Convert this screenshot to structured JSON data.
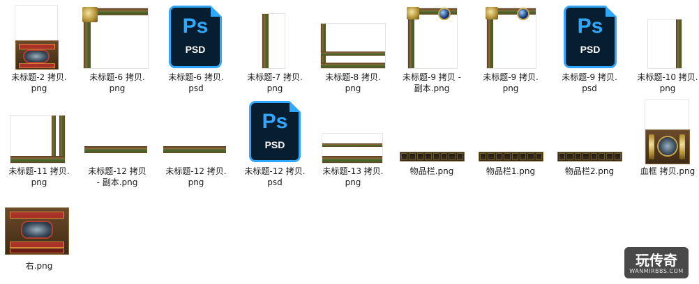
{
  "files": [
    {
      "name": "未标题-2 拷贝.png",
      "line1": "未标题-2 拷贝.",
      "line2": "png",
      "kind": "png-ornate-tall"
    },
    {
      "name": "未标题-6 拷贝.png",
      "line1": "未标题-6 拷贝.",
      "line2": "png",
      "kind": "png-frame-corner"
    },
    {
      "name": "未标题-6 拷贝.psd",
      "line1": "未标题-6 拷贝.",
      "line2": "psd",
      "kind": "psd"
    },
    {
      "name": "未标题-7 拷贝.png",
      "line1": "未标题-7 拷贝.",
      "line2": "png",
      "kind": "png-vertical-strip"
    },
    {
      "name": "未标题-8 拷贝.png",
      "line1": "未标题-8 拷贝.",
      "line2": "png",
      "kind": "png-frame-wide"
    },
    {
      "name": "未标题-9 拷贝 - 副本.png",
      "line1": "未标题-9 拷贝 -",
      "line2": "副本.png",
      "kind": "png-frame-gem"
    },
    {
      "name": "未标题-9 拷贝.png",
      "line1": "未标题-9 拷贝.",
      "line2": "png",
      "kind": "png-frame-gem"
    },
    {
      "name": "未标题-9 拷贝.psd",
      "line1": "未标题-9 拷贝.",
      "line2": "psd",
      "kind": "psd"
    },
    {
      "name": "未标题-10 拷贝.png",
      "line1": "未标题-10 拷贝.",
      "line2": "png",
      "kind": "png-frame-right"
    },
    {
      "name": "未标题-11 拷贝.png",
      "line1": "未标题-11 拷贝.",
      "line2": "png",
      "kind": "png-frame-bottom-right"
    },
    {
      "name": "未标题-12 拷贝 - 副本.png",
      "line1": "未标题-12 拷贝",
      "line2": "- 副本.png",
      "kind": "png-bar"
    },
    {
      "name": "未标题-12 拷贝.png",
      "line1": "未标题-12 拷贝.",
      "line2": "png",
      "kind": "png-bar"
    },
    {
      "name": "未标题-12 拷贝.psd",
      "line1": "未标题-12 拷贝.",
      "line2": "psd",
      "kind": "psd"
    },
    {
      "name": "未标题-13 拷贝.png",
      "line1": "未标题-13 拷贝.",
      "line2": "png",
      "kind": "png-frame-short"
    },
    {
      "name": "物品栏.png",
      "line1": "物品栏.png",
      "line2": "",
      "kind": "png-slotbar"
    },
    {
      "name": "物品栏1.png",
      "line1": "物品栏1.png",
      "line2": "",
      "kind": "png-slotbar"
    },
    {
      "name": "物品栏2.png",
      "line1": "物品栏2.png",
      "line2": "",
      "kind": "png-slotbar"
    },
    {
      "name": "血框 拷贝.png",
      "line1": "血框 拷贝.png",
      "line2": "",
      "kind": "png-bloodframe"
    },
    {
      "name": "右.png",
      "line1": "右.png",
      "line2": "",
      "kind": "png-ornate-wide"
    }
  ],
  "psd_icon": {
    "letters": "Ps",
    "ext": "PSD",
    "accent": "#31a8ff",
    "bg": "#061e2f"
  },
  "watermark": {
    "title": "玩传奇",
    "subtitle": "WANMIRBBS.COM"
  }
}
